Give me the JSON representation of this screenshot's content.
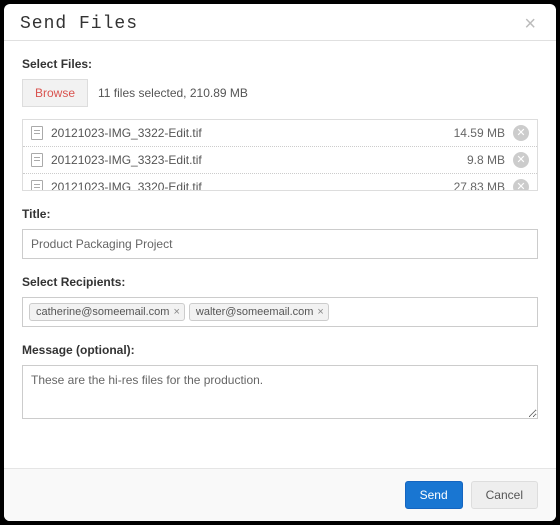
{
  "dialog": {
    "title": "Send Files"
  },
  "files_section": {
    "label": "Select Files:",
    "browse_label": "Browse",
    "summary": "11 files selected, 210.89 MB",
    "files": [
      {
        "name": "20121023-IMG_3322-Edit.tif",
        "size": "14.59 MB"
      },
      {
        "name": "20121023-IMG_3323-Edit.tif",
        "size": "9.8 MB"
      },
      {
        "name": "20121023-IMG_3320-Edit.tif",
        "size": "27.83 MB"
      }
    ]
  },
  "title_section": {
    "label": "Title:",
    "value": "Product Packaging Project"
  },
  "recipients_section": {
    "label": "Select Recipients:",
    "recipients": [
      "catherine@someemail.com",
      "walter@someemail.com"
    ]
  },
  "message_section": {
    "label": "Message (optional):",
    "value": "These are the hi-res files for the production."
  },
  "footer": {
    "send_label": "Send",
    "cancel_label": "Cancel"
  }
}
